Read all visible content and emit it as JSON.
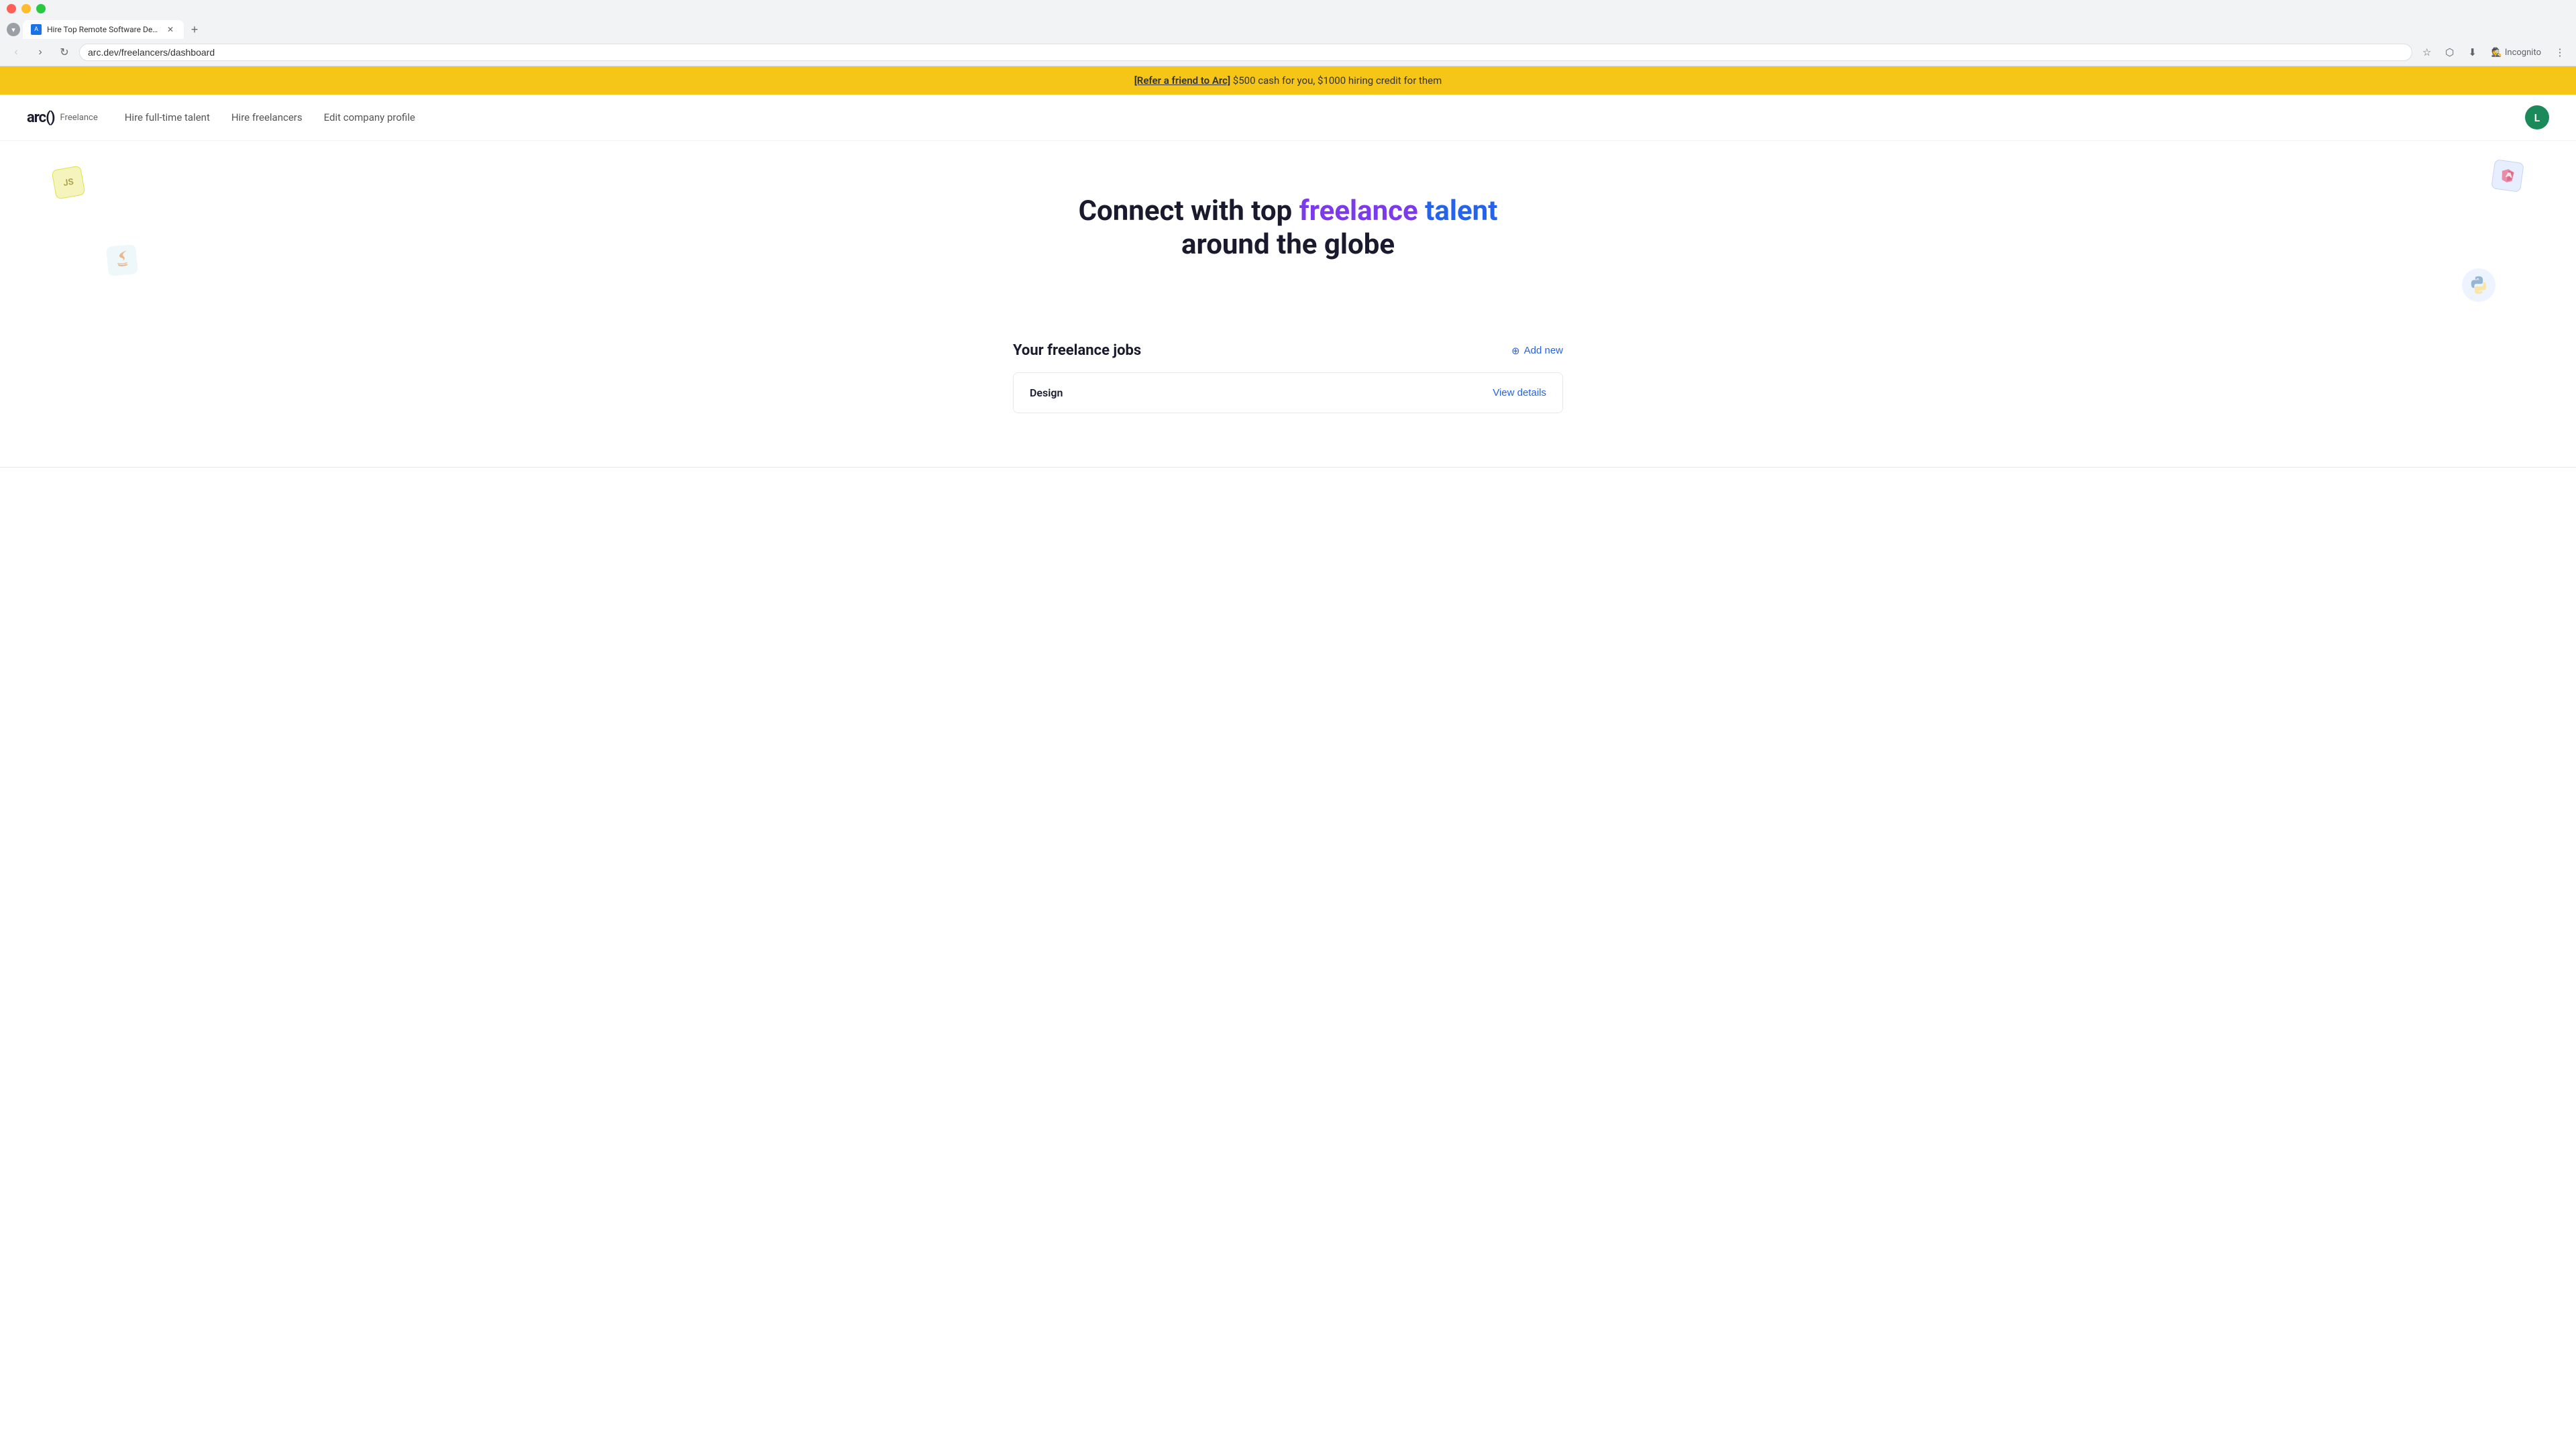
{
  "browser": {
    "tab": {
      "title": "Hire Top Remote Software Dev…",
      "favicon_text": "A"
    },
    "url": "arc.dev/freelancers/dashboard",
    "incognito_label": "Incognito"
  },
  "banner": {
    "link_text": "[Refer a friend to Arc]",
    "message": " $500 cash for you, $1000 hiring credit for them"
  },
  "nav": {
    "logo_text": "arc()",
    "logo_badge": "Freelance",
    "links": [
      {
        "id": "hire-fulltime",
        "label": "Hire full-time talent"
      },
      {
        "id": "hire-freelancers",
        "label": "Hire freelancers"
      },
      {
        "id": "edit-company",
        "label": "Edit company profile"
      }
    ],
    "user_initial": "L"
  },
  "hero": {
    "title_part1": "Connect with top ",
    "title_highlight1": "freelance",
    "title_space": " ",
    "title_highlight2": "talent",
    "title_part2": "around the globe"
  },
  "jobs": {
    "section_title": "Your freelance jobs",
    "add_new_label": "Add new",
    "items": [
      {
        "name": "Design",
        "view_label": "View details"
      }
    ]
  }
}
